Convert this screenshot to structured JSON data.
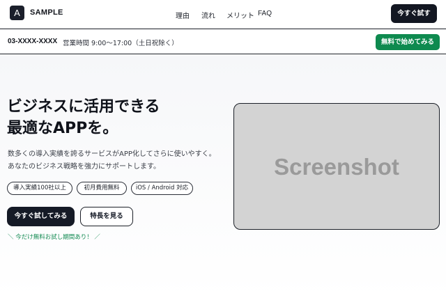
{
  "header": {
    "logo_letter": "A",
    "logo_text": "SAMPLE",
    "nav": [
      "理由",
      "流れ",
      "メリット",
      "FAQ"
    ],
    "cta_label": "今すぐ試す"
  },
  "subbar": {
    "phone": "03-XXXX-XXXX",
    "hours": "営業時間 9:00〜17:00（土日祝除く）",
    "cta_label": "無料で始めてみる"
  },
  "hero": {
    "headline": [
      "ビジネスに活用できる",
      "最適なAPPを。"
    ],
    "lead": [
      "数多くの導入実績を誇るサービスがAPP化してさらに使いやすく。",
      "あなたのビジネス戦略を強力にサポートします。"
    ],
    "chips": [
      "導入実績100社以上",
      "初月費用無料",
      "iOS / Android 対応"
    ],
    "primary_label": "今すぐ試してみる",
    "secondary_label": "特長を見る",
    "trial_note": "＼ 今だけ無料お試し期間あり！ ／",
    "screenshot_label": "Screenshot"
  },
  "colors": {
    "dark": "#131722",
    "accent_green": "#0e8a4f",
    "placeholder_gray": "#d3d3d3"
  }
}
